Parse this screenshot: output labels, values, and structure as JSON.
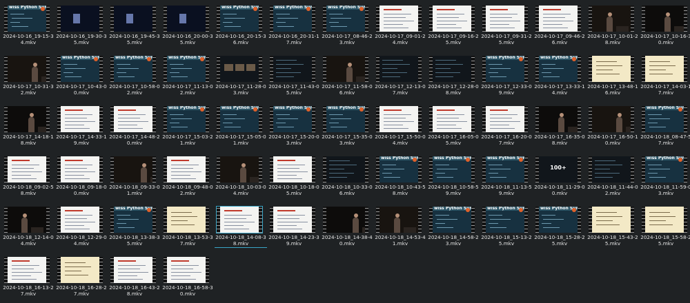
{
  "colors": {
    "background": "#1f2224",
    "text": "#e6e6e6",
    "selection": "#3aa7c8",
    "slide_accent": "#e0612a"
  },
  "slide_banner_text": "wiss Python Summit",
  "files": [
    {
      "name": "2024-10-16_19-15-34.mkv",
      "kind": "slide"
    },
    {
      "name": "2024-10-16_19-30-35.mkv",
      "kind": "videoblue"
    },
    {
      "name": "2024-10-16_19-45-35.mkv",
      "kind": "videoblue"
    },
    {
      "name": "2024-10-16_20-00-35.mkv",
      "kind": "videoblue"
    },
    {
      "name": "2024-10-16_20-15-36.mkv",
      "kind": "slide"
    },
    {
      "name": "2024-10-16_20-31-17.mkv",
      "kind": "slide"
    },
    {
      "name": "2024-10-17_08-46-23.mkv",
      "kind": "slide"
    },
    {
      "name": "2024-10-17_09-01-24.mkv",
      "kind": "white"
    },
    {
      "name": "2024-10-17_09-16-25.mkv",
      "kind": "white"
    },
    {
      "name": "2024-10-17_09-31-25.mkv",
      "kind": "white"
    },
    {
      "name": "2024-10-17_09-46-26.mkv",
      "kind": "white"
    },
    {
      "name": "2024-10-17_10-01-28.mkv",
      "kind": "stage"
    },
    {
      "name": "2024-10-17_10-16-30.mkv",
      "kind": "stage"
    },
    {
      "name": "2024-10-17_10-31-32.mkv",
      "kind": "stage"
    },
    {
      "name": "2024-10-17_10-43-00.mkv",
      "kind": "slide"
    },
    {
      "name": "2024-10-17_10-58-02.mkv",
      "kind": "slide"
    },
    {
      "name": "2024-10-17_11-13-02.mkv",
      "kind": "slide"
    },
    {
      "name": "2024-10-17_11-28-03.mkv",
      "kind": "tile3"
    },
    {
      "name": "2024-10-17_11-43-05.mkv",
      "kind": "dark"
    },
    {
      "name": "2024-10-17_11-58-06.mkv",
      "kind": "stage"
    },
    {
      "name": "2024-10-17_12-13-07.mkv",
      "kind": "dark"
    },
    {
      "name": "2024-10-17_12-28-08.mkv",
      "kind": "dark"
    },
    {
      "name": "2024-10-17_12-33-09.mkv",
      "kind": "slide"
    },
    {
      "name": "2024-10-17_13-33-14.mkv",
      "kind": "slide"
    },
    {
      "name": "2024-10-17_13-48-16.mkv",
      "kind": "cream"
    },
    {
      "name": "2024-10-17_14-03-17.mkv",
      "kind": "cream"
    },
    {
      "name": "2024-10-17_14-18-18.mkv",
      "kind": "stage"
    },
    {
      "name": "2024-10-17_14-33-19.mkv",
      "kind": "white"
    },
    {
      "name": "2024-10-17_14-48-20.mkv",
      "kind": "white"
    },
    {
      "name": "2024-10-17_15-03-21.mkv",
      "kind": "slide"
    },
    {
      "name": "2024-10-17_15-05-01.mkv",
      "kind": "slide"
    },
    {
      "name": "2024-10-17_15-20-03.mkv",
      "kind": "slide"
    },
    {
      "name": "2024-10-17_15-35-03.mkv",
      "kind": "slide"
    },
    {
      "name": "2024-10-17_15-50-04.mkv",
      "kind": "white"
    },
    {
      "name": "2024-10-17_16-05-05.mkv",
      "kind": "white"
    },
    {
      "name": "2024-10-17_16-20-07.mkv",
      "kind": "white"
    },
    {
      "name": "2024-10-17_16-35-08.mkv",
      "kind": "stage"
    },
    {
      "name": "2024-10-17_16-50-10.mkv",
      "kind": "stage"
    },
    {
      "name": "2024-10-18_08-47-57.mkv",
      "kind": "slide"
    },
    {
      "name": "2024-10-18_09-02-58.mkv",
      "kind": "white"
    },
    {
      "name": "2024-10-18_09-18-00.mkv",
      "kind": "white"
    },
    {
      "name": "2024-10-18_09-33-01.mkv",
      "kind": "stage"
    },
    {
      "name": "2024-10-18_09-48-02.mkv",
      "kind": "white"
    },
    {
      "name": "2024-10-18_10-03-04.mkv",
      "kind": "stage"
    },
    {
      "name": "2024-10-18_10-18-05.mkv",
      "kind": "white"
    },
    {
      "name": "2024-10-18_10-33-06.mkv",
      "kind": "dark"
    },
    {
      "name": "2024-10-18_10-43-58.mkv",
      "kind": "slide"
    },
    {
      "name": "2024-10-18_10-58-59.mkv",
      "kind": "slide"
    },
    {
      "name": "2024-10-18_11-13-59.mkv",
      "kind": "slide"
    },
    {
      "name": "2024-10-18_11-29-00.mkv",
      "kind": "big100",
      "text": "100+"
    },
    {
      "name": "2024-10-18_11-44-02.mkv",
      "kind": "dark"
    },
    {
      "name": "2024-10-18_11-59-03.mkv",
      "kind": "slide"
    },
    {
      "name": "2024-10-18_12-14-04.mkv",
      "kind": "stage"
    },
    {
      "name": "2024-10-18_12-29-04.mkv",
      "kind": "white"
    },
    {
      "name": "2024-10-18_13-38-35.mkv",
      "kind": "slide"
    },
    {
      "name": "2024-10-18_13-53-37.mkv",
      "kind": "cream"
    },
    {
      "name": "2024-10-18_14-08-38.mkv",
      "kind": "white",
      "selected": true
    },
    {
      "name": "2024-10-18_14-23-39.mkv",
      "kind": "white"
    },
    {
      "name": "2024-10-18_14-38-40.mkv",
      "kind": "stage"
    },
    {
      "name": "2024-10-18_14-53-41.mkv",
      "kind": "stage"
    },
    {
      "name": "2024-10-18_14-58-23.mkv",
      "kind": "slide"
    },
    {
      "name": "2024-10-18_15-13-25.mkv",
      "kind": "slide"
    },
    {
      "name": "2024-10-18_15-28-25.mkv",
      "kind": "slide"
    },
    {
      "name": "2024-10-18_15-43-25.mkv",
      "kind": "cream"
    },
    {
      "name": "2024-10-18_15-58-25.mkv",
      "kind": "cream"
    },
    {
      "name": "2024-10-18_16-13-27.mkv",
      "kind": "white"
    },
    {
      "name": "2024-10-18_16-28-27.mkv",
      "kind": "cream"
    },
    {
      "name": "2024-10-18_16-43-28.mkv",
      "kind": "white"
    },
    {
      "name": "2024-10-18_16-58-30.mkv",
      "kind": "white"
    }
  ]
}
